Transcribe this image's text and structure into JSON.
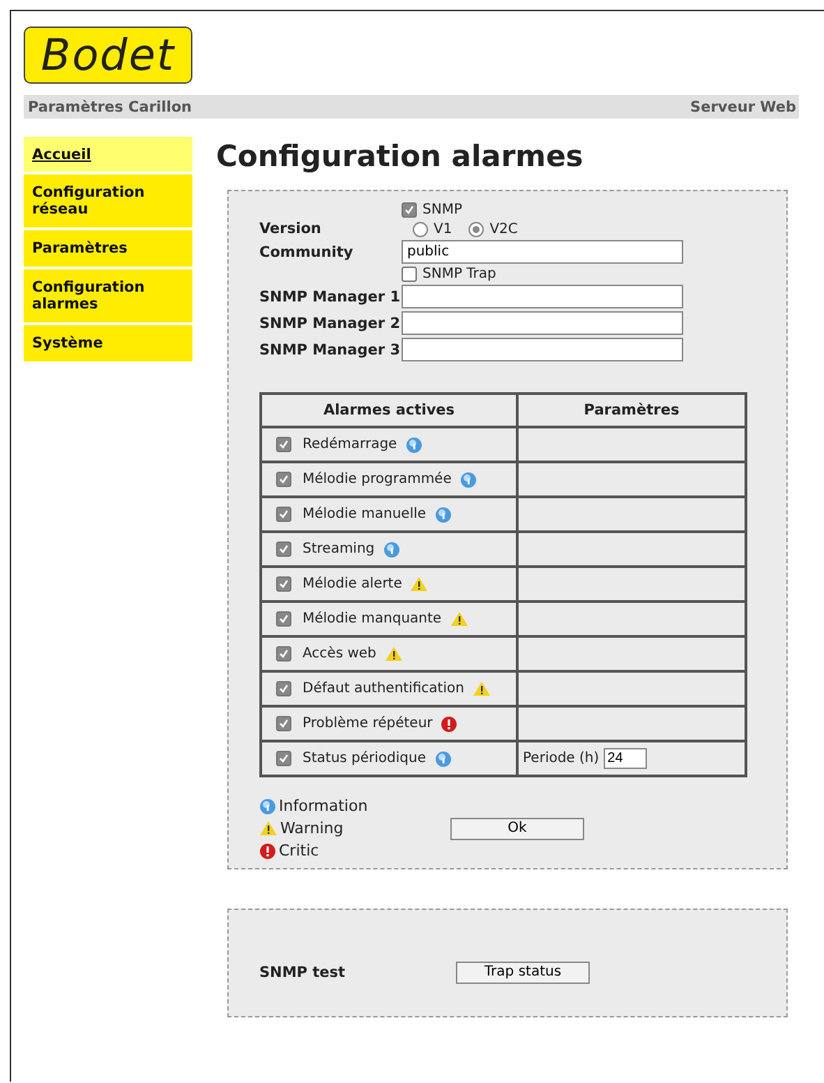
{
  "logo": "Bodet",
  "header": {
    "left": "Paramètres Carillon",
    "right": "Serveur Web"
  },
  "sidebar": {
    "items": [
      {
        "label": "Accueil",
        "selected": true
      },
      {
        "label": "Configuration réseau",
        "selected": false
      },
      {
        "label": "Paramètres",
        "selected": false
      },
      {
        "label": "Configuration alarmes",
        "selected": false
      },
      {
        "label": "Système",
        "selected": false
      }
    ]
  },
  "title": "Configuration alarmes",
  "snmp": {
    "label": "SNMP",
    "checked": true
  },
  "version": {
    "label": "Version",
    "options": [
      {
        "label": "V1",
        "selected": false
      },
      {
        "label": "V2C",
        "selected": true
      }
    ]
  },
  "community": {
    "label": "Community",
    "value": "public"
  },
  "trap": {
    "label": "SNMP Trap",
    "checked": false
  },
  "managers": [
    {
      "label": "SNMP Manager 1"
    },
    {
      "label": "SNMP Manager 2"
    },
    {
      "label": "SNMP Manager 3"
    }
  ],
  "table": {
    "columns": [
      "Alarmes actives",
      "Paramètres"
    ],
    "rows": [
      {
        "label": "Redémarrage",
        "checked": true,
        "kind": "info"
      },
      {
        "label": "Mélodie programmée",
        "checked": true,
        "kind": "info"
      },
      {
        "label": "Mélodie manuelle",
        "checked": true,
        "kind": "info"
      },
      {
        "label": "Streaming",
        "checked": true,
        "kind": "info"
      },
      {
        "label": "Mélodie alerte",
        "checked": true,
        "kind": "warning"
      },
      {
        "label": "Mélodie manquante",
        "checked": true,
        "kind": "warning"
      },
      {
        "label": "Accès web",
        "checked": true,
        "kind": "warning"
      },
      {
        "label": "Défaut authentification",
        "checked": true,
        "kind": "warning"
      },
      {
        "label": "Problème répéteur",
        "checked": true,
        "kind": "critic"
      },
      {
        "label": "Status périodique",
        "checked": true,
        "kind": "info",
        "param_label": "Periode (h)",
        "param_value": "24"
      }
    ]
  },
  "legend": [
    {
      "kind": "info",
      "label": "Information"
    },
    {
      "kind": "warning",
      "label": "Warning"
    },
    {
      "kind": "critic",
      "label": "Critic"
    }
  ],
  "ok_button": "Ok",
  "test": {
    "label": "SNMP test",
    "button": "Trap status"
  }
}
